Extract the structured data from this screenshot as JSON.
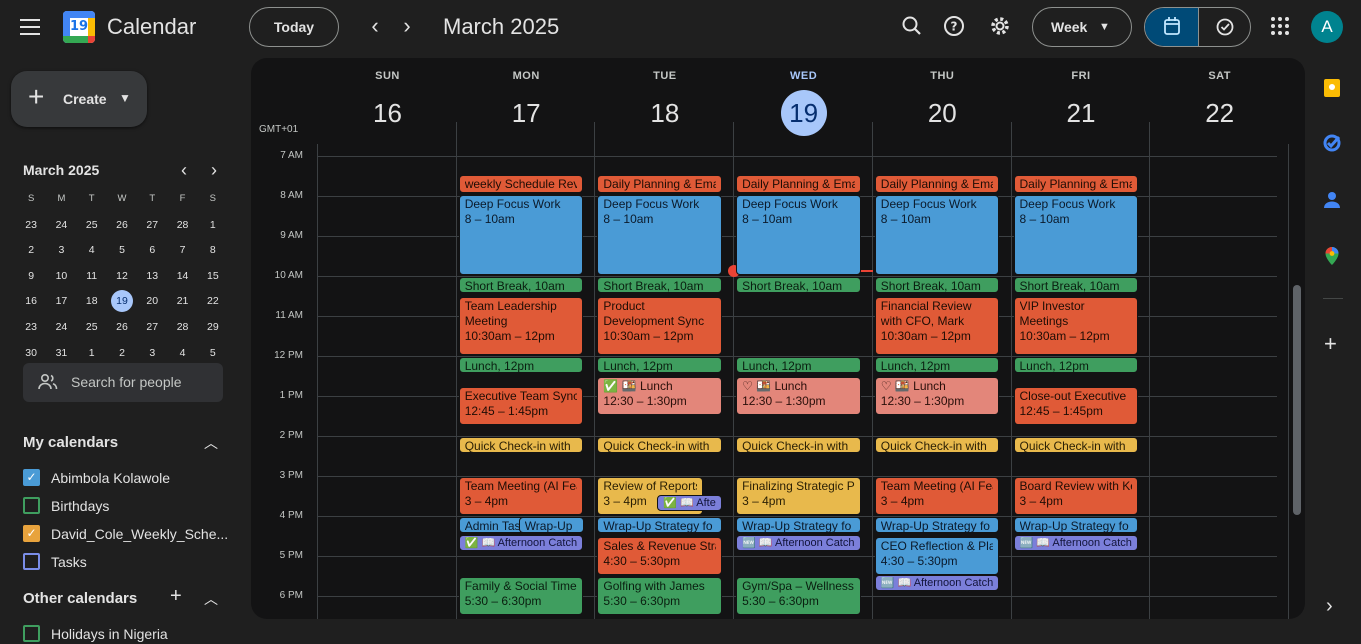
{
  "header": {
    "app_name": "Calendar",
    "logo_day": "19",
    "today_label": "Today",
    "prev_icon": "chevron-left-icon",
    "next_icon": "chevron-right-icon",
    "title": "March 2025",
    "view_label": "Week",
    "avatar_letter": "A"
  },
  "sidebar": {
    "create_label": "Create",
    "mini_month": {
      "title": "March 2025",
      "weekday_headers": [
        "S",
        "M",
        "T",
        "W",
        "T",
        "F",
        "S"
      ],
      "weeks": [
        [
          "23",
          "24",
          "25",
          "26",
          "27",
          "28",
          "1"
        ],
        [
          "2",
          "3",
          "4",
          "5",
          "6",
          "7",
          "8"
        ],
        [
          "9",
          "10",
          "11",
          "12",
          "13",
          "14",
          "15"
        ],
        [
          "16",
          "17",
          "18",
          "19",
          "20",
          "21",
          "22"
        ],
        [
          "23",
          "24",
          "25",
          "26",
          "27",
          "28",
          "29"
        ],
        [
          "30",
          "31",
          "1",
          "2",
          "3",
          "4",
          "5"
        ]
      ],
      "today": "19"
    },
    "search_people_label": "Search for people",
    "my_calendars_title": "My calendars",
    "my_calendars": [
      {
        "name": "Abimbola Kolawole",
        "color": "#4a9bd6",
        "checked": true
      },
      {
        "name": "Birthdays",
        "color": "#3f9e5f",
        "checked": false
      },
      {
        "name": "David_Cole_Weekly_Sche...",
        "color": "#e8a33d",
        "checked": true
      },
      {
        "name": "Tasks",
        "color": "#7b8ee8",
        "checked": false
      }
    ],
    "other_calendars_title": "Other calendars",
    "other_calendars": [
      {
        "name": "Holidays in Nigeria",
        "color": "#3f9e5f",
        "checked": false
      }
    ]
  },
  "week": {
    "timezone": "GMT+01",
    "days": [
      {
        "name": "SUN",
        "date": "16"
      },
      {
        "name": "MON",
        "date": "17"
      },
      {
        "name": "TUE",
        "date": "18"
      },
      {
        "name": "WED",
        "date": "19",
        "current": true
      },
      {
        "name": "THU",
        "date": "20"
      },
      {
        "name": "FRI",
        "date": "21"
      },
      {
        "name": "SAT",
        "date": "22"
      }
    ],
    "hours": [
      "7 AM",
      "8 AM",
      "9 AM",
      "10 AM",
      "11 AM",
      "12 PM",
      "1 PM",
      "2 PM",
      "3 PM",
      "4 PM",
      "5 PM",
      "6 PM"
    ]
  },
  "events": [
    {
      "day": 1,
      "start": 7.45,
      "end": 7.95,
      "color": "red",
      "title": "weekly Schedule Rev"
    },
    {
      "day": 2,
      "start": 7.45,
      "end": 7.95,
      "color": "red",
      "title": "Daily Planning & Ema"
    },
    {
      "day": 3,
      "start": 7.45,
      "end": 7.95,
      "color": "red",
      "title": "Daily Planning & Ema"
    },
    {
      "day": 4,
      "start": 7.45,
      "end": 7.95,
      "color": "red",
      "title": "Daily Planning & Ema"
    },
    {
      "day": 5,
      "start": 7.45,
      "end": 7.95,
      "color": "red",
      "title": "Daily Planning & Ema"
    },
    {
      "day": 1,
      "start": 7.95,
      "end": 10,
      "color": "blue",
      "title": "Deep Focus Work",
      "time": "8 – 10am"
    },
    {
      "day": 2,
      "start": 7.95,
      "end": 10,
      "color": "blue",
      "title": "Deep Focus Work",
      "time": "8 – 10am"
    },
    {
      "day": 3,
      "start": 7.95,
      "end": 10,
      "color": "blue",
      "title": "Deep Focus Work",
      "time": "8 – 10am"
    },
    {
      "day": 4,
      "start": 7.95,
      "end": 10,
      "color": "blue",
      "title": "Deep Focus Work",
      "time": "8 – 10am"
    },
    {
      "day": 5,
      "start": 7.95,
      "end": 10,
      "color": "blue",
      "title": "Deep Focus Work",
      "time": "8 – 10am"
    },
    {
      "day": 1,
      "start": 10,
      "end": 10.45,
      "color": "green",
      "title": "Short Break, 10am"
    },
    {
      "day": 2,
      "start": 10,
      "end": 10.45,
      "color": "green",
      "title": "Short Break, 10am"
    },
    {
      "day": 3,
      "start": 10,
      "end": 10.45,
      "color": "green",
      "title": "Short Break, 10am"
    },
    {
      "day": 4,
      "start": 10,
      "end": 10.45,
      "color": "green",
      "title": "Short Break, 10am"
    },
    {
      "day": 5,
      "start": 10,
      "end": 10.45,
      "color": "green",
      "title": "Short Break, 10am"
    },
    {
      "day": 1,
      "start": 10.5,
      "end": 12,
      "color": "red",
      "title": "Team Leadership Meeting",
      "time": "10:30am – 12pm",
      "wrap": true
    },
    {
      "day": 2,
      "start": 10.5,
      "end": 12,
      "color": "red",
      "title": "Product Development Sync",
      "time": "10:30am – 12pm",
      "wrap": true
    },
    {
      "day": 4,
      "start": 10.5,
      "end": 12,
      "color": "red",
      "title": "Financial Review with CFO, Mark",
      "time": "10:30am – 12pm",
      "wrap": true
    },
    {
      "day": 5,
      "start": 10.5,
      "end": 12,
      "color": "red",
      "title": "VIP Investor Meetings",
      "time": "10:30am – 12pm",
      "wrap": true
    },
    {
      "day": 1,
      "start": 12,
      "end": 12.45,
      "color": "green",
      "title": "Lunch, 12pm"
    },
    {
      "day": 2,
      "start": 12,
      "end": 12.45,
      "color": "green",
      "title": "Lunch, 12pm"
    },
    {
      "day": 3,
      "start": 12,
      "end": 12.45,
      "color": "green",
      "title": "Lunch, 12pm"
    },
    {
      "day": 4,
      "start": 12,
      "end": 12.45,
      "color": "green",
      "title": "Lunch, 12pm"
    },
    {
      "day": 5,
      "start": 12,
      "end": 12.45,
      "color": "green",
      "title": "Lunch, 12pm"
    },
    {
      "day": 1,
      "start": 12.75,
      "end": 13.75,
      "color": "red",
      "title": "Executive Team Sync",
      "time": "12:45 – 1:45pm"
    },
    {
      "day": 2,
      "start": 12.5,
      "end": 13.5,
      "color": "pink",
      "title": "✅ 🍱 Lunch",
      "time": "12:30 – 1:30pm"
    },
    {
      "day": 3,
      "start": 12.5,
      "end": 13.5,
      "color": "pink",
      "title": "♡ 🍱 Lunch",
      "time": "12:30 – 1:30pm"
    },
    {
      "day": 4,
      "start": 12.5,
      "end": 13.5,
      "color": "pink",
      "title": "♡ 🍱 Lunch",
      "time": "12:30 – 1:30pm"
    },
    {
      "day": 5,
      "start": 12.75,
      "end": 13.75,
      "color": "red",
      "title": "Close-out Executive",
      "time": "12:45 – 1:45pm"
    },
    {
      "day": 1,
      "start": 14,
      "end": 14.45,
      "color": "yellow",
      "title": "Quick Check-in with"
    },
    {
      "day": 2,
      "start": 14,
      "end": 14.45,
      "color": "yellow",
      "title": "Quick Check-in with"
    },
    {
      "day": 3,
      "start": 14,
      "end": 14.45,
      "color": "yellow",
      "title": "Quick Check-in with"
    },
    {
      "day": 4,
      "start": 14,
      "end": 14.45,
      "color": "yellow",
      "title": "Quick Check-in with"
    },
    {
      "day": 5,
      "start": 14,
      "end": 14.45,
      "color": "yellow",
      "title": "Quick Check-in with"
    },
    {
      "day": 1,
      "start": 15,
      "end": 16,
      "color": "red",
      "title": "Team Meeting (AI Fea",
      "time": "3 – 4pm"
    },
    {
      "day": 2,
      "start": 15,
      "end": 16,
      "color": "yellow",
      "title": "Review of Reports",
      "time": "3 – 4pm",
      "narrow": true
    },
    {
      "day": 3,
      "start": 15,
      "end": 16,
      "color": "yellow",
      "title": "Finalizing Strategic P",
      "time": "3 – 4pm"
    },
    {
      "day": 4,
      "start": 15,
      "end": 16,
      "color": "red",
      "title": "Team Meeting (AI Fea",
      "time": "3 – 4pm"
    },
    {
      "day": 5,
      "start": 15,
      "end": 16,
      "color": "red",
      "title": "Board Review with Ke",
      "time": "3 – 4pm"
    },
    {
      "day": 2,
      "start": 15.45,
      "end": 15.85,
      "color": "purple",
      "title": "✅ 📖 Afte",
      "offset": true
    },
    {
      "day": 1,
      "start": 16,
      "end": 16.45,
      "color": "blue",
      "title": "Admin Tas",
      "narrow": true
    },
    {
      "day": 1,
      "start": 16,
      "end": 16.45,
      "color": "blue",
      "title": "Wrap-Up",
      "offset": true
    },
    {
      "day": 2,
      "start": 16,
      "end": 16.45,
      "color": "blue",
      "title": "Wrap-Up Strategy fo"
    },
    {
      "day": 3,
      "start": 16,
      "end": 16.45,
      "color": "blue",
      "title": "Wrap-Up Strategy fo"
    },
    {
      "day": 4,
      "start": 16,
      "end": 16.45,
      "color": "blue",
      "title": "Wrap-Up Strategy fo"
    },
    {
      "day": 5,
      "start": 16,
      "end": 16.45,
      "color": "blue",
      "title": "Wrap-Up Strategy fo"
    },
    {
      "day": 1,
      "start": 16.45,
      "end": 16.85,
      "color": "purple",
      "title": "✅ 📖 Afternoon Catch"
    },
    {
      "day": 3,
      "start": 16.45,
      "end": 16.85,
      "color": "purple",
      "title": "🆕 📖 Afternoon Catch"
    },
    {
      "day": 5,
      "start": 16.45,
      "end": 16.85,
      "color": "purple",
      "title": "🆕 📖 Afternoon Catch"
    },
    {
      "day": 2,
      "start": 16.5,
      "end": 17.5,
      "color": "red",
      "title": "Sales & Revenue Stra",
      "time": "4:30 – 5:30pm"
    },
    {
      "day": 4,
      "start": 16.5,
      "end": 17.5,
      "color": "blue",
      "title": "CEO Reflection & Pla",
      "time": "4:30 – 5:30pm"
    },
    {
      "day": 4,
      "start": 17.45,
      "end": 17.85,
      "color": "purple",
      "title": "🆕 📖 Afternoon Catch"
    },
    {
      "day": 1,
      "start": 17.5,
      "end": 18.5,
      "color": "green",
      "title": "Family & Social Time",
      "time": "5:30 – 6:30pm"
    },
    {
      "day": 2,
      "start": 17.5,
      "end": 18.5,
      "color": "green",
      "title": "Golfing with James",
      "time": "5:30 – 6:30pm"
    },
    {
      "day": 3,
      "start": 17.5,
      "end": 18.5,
      "color": "green",
      "title": "Gym/Spa – Wellness",
      "time": "5:30 – 6:30pm"
    }
  ],
  "now_indicator": {
    "day": 3,
    "hour": 9.85
  }
}
